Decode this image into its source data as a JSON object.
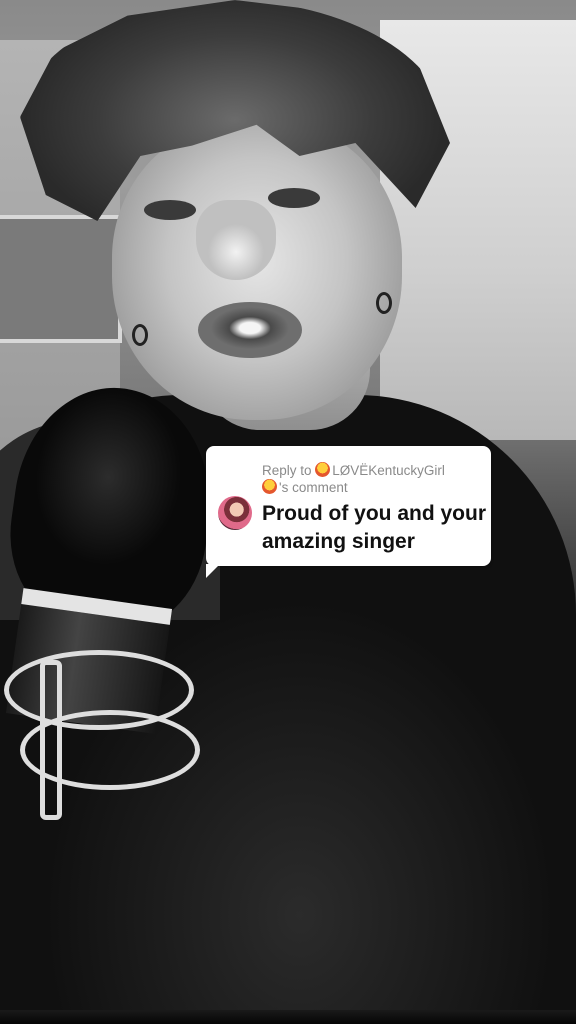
{
  "reply_sticker": {
    "prefix": "Reply to ",
    "username": "LØVËKentuckyGirl",
    "suffix": "'s comment",
    "emoji_icon": "lion-emoji-icon",
    "comment_text": "Proud of you and your amazing singer"
  },
  "colors": {
    "sticker_bg": "#ffffff",
    "header_text": "#8a8a8a",
    "comment_text": "#111111"
  }
}
